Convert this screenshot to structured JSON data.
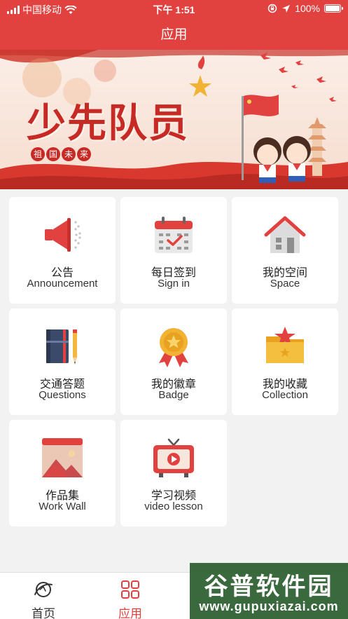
{
  "status_bar": {
    "carrier": "中国移动",
    "time": "下午 1:51",
    "battery": "100%"
  },
  "nav": {
    "title": "应用"
  },
  "banner": {
    "title": "少先队员",
    "subtitle_chars": [
      "祖",
      "国",
      "未",
      "来"
    ]
  },
  "apps": [
    {
      "zh": "公告",
      "en": "Announcement",
      "icon": "megaphone-icon"
    },
    {
      "zh": "每日签到",
      "en": "Sign in",
      "icon": "calendar-check-icon"
    },
    {
      "zh": "我的空间",
      "en": "Space",
      "icon": "house-icon"
    },
    {
      "zh": "交通答题",
      "en": "Questions",
      "icon": "notebook-pencil-icon"
    },
    {
      "zh": "我的徽章",
      "en": "Badge",
      "icon": "medal-icon"
    },
    {
      "zh": "我的收藏",
      "en": "Collection",
      "icon": "folder-star-icon"
    },
    {
      "zh": "作品集",
      "en": "Work Wall",
      "icon": "gallery-icon"
    },
    {
      "zh": "学习视频",
      "en": "video lesson",
      "icon": "tv-play-icon"
    }
  ],
  "tabbar": {
    "tabs": [
      {
        "label": "首页",
        "icon": "planet-icon",
        "active": false
      },
      {
        "label": "应用",
        "icon": "grid-icon",
        "active": true
      }
    ]
  },
  "watermark": {
    "line1": "谷普软件园",
    "line2": "www.gupuxiazai.com"
  },
  "colors": {
    "brand_red": "#e2423f",
    "background": "#f2f2f2"
  }
}
